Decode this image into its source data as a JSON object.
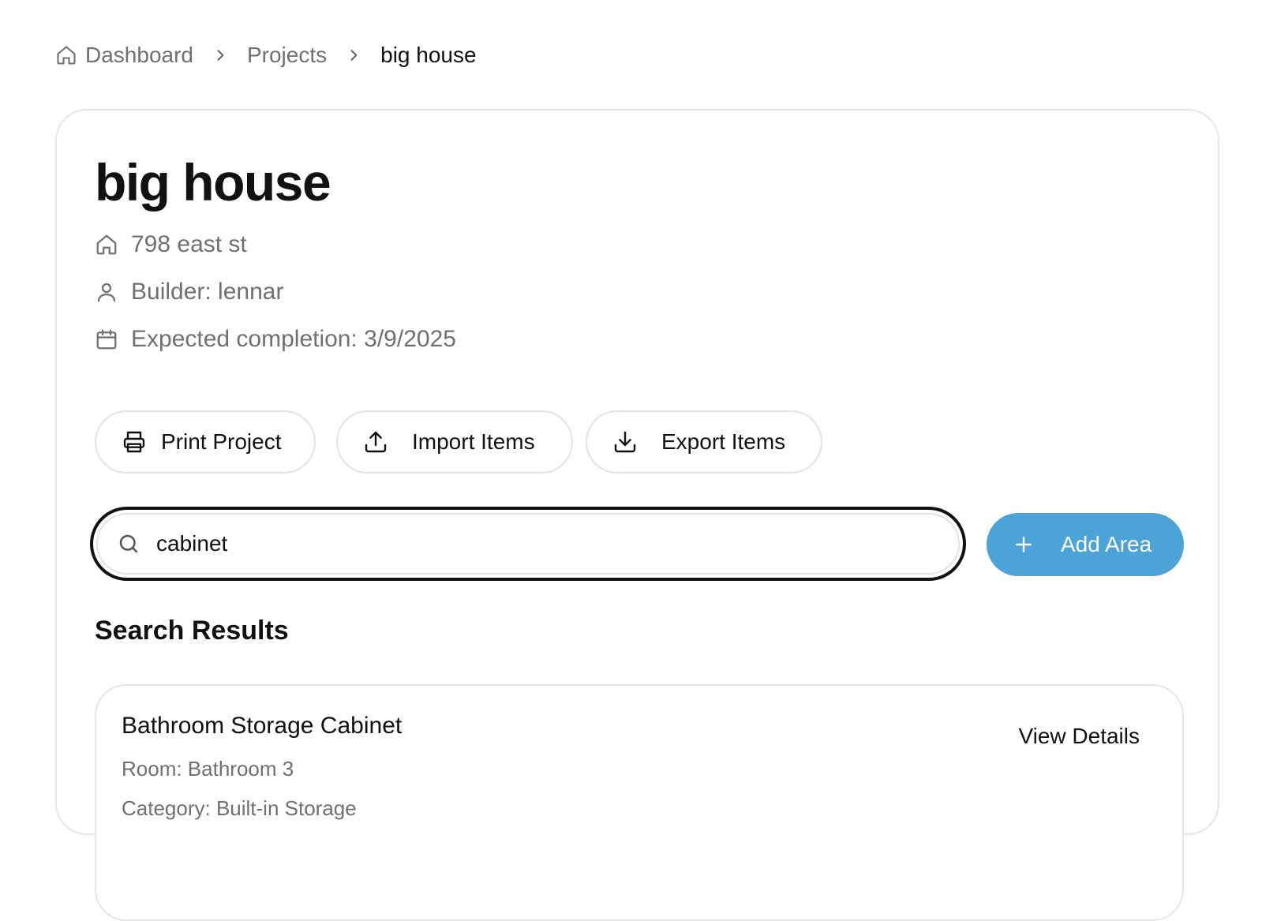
{
  "breadcrumb": {
    "items": [
      {
        "label": "Dashboard",
        "icon": "home-icon"
      },
      {
        "label": "Projects"
      },
      {
        "label": "big house"
      }
    ],
    "separator_icon": "chevron-right-icon"
  },
  "project": {
    "title": "big house",
    "address": "798 east st",
    "builder": "Builder: lennar",
    "completion": "Expected completion: 3/9/2025"
  },
  "actions": {
    "print_label": "Print Project",
    "import_label": "Import Items",
    "export_label": "Export Items"
  },
  "search": {
    "value": "cabinet",
    "icon": "search-icon"
  },
  "add_area": {
    "label": "Add Area",
    "color": "#4ba3d8"
  },
  "results": {
    "heading": "Search Results",
    "items": [
      {
        "name": "Bathroom Storage Cabinet",
        "room": "Room: Bathroom 3",
        "category": "Category: Built-in Storage",
        "action_label": "View Details"
      }
    ]
  }
}
